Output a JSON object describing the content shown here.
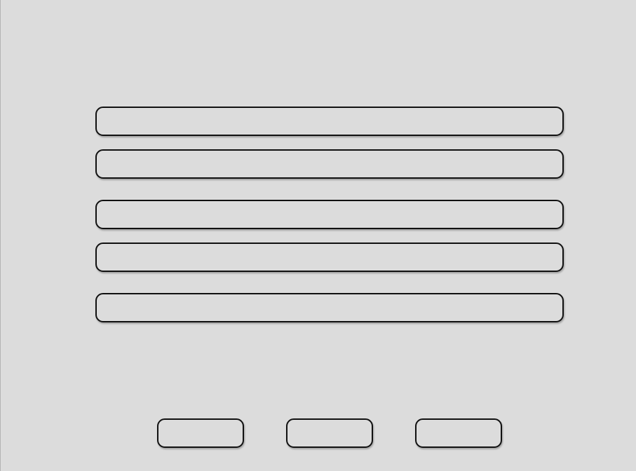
{
  "form": {
    "fields": [
      {
        "value": "",
        "placeholder": ""
      },
      {
        "value": "",
        "placeholder": ""
      },
      {
        "value": "",
        "placeholder": ""
      },
      {
        "value": "",
        "placeholder": ""
      },
      {
        "value": "",
        "placeholder": ""
      }
    ]
  },
  "buttons": [
    {
      "label": ""
    },
    {
      "label": ""
    },
    {
      "label": ""
    }
  ],
  "colors": {
    "background": "#dcdcdc",
    "border": "#111111"
  }
}
